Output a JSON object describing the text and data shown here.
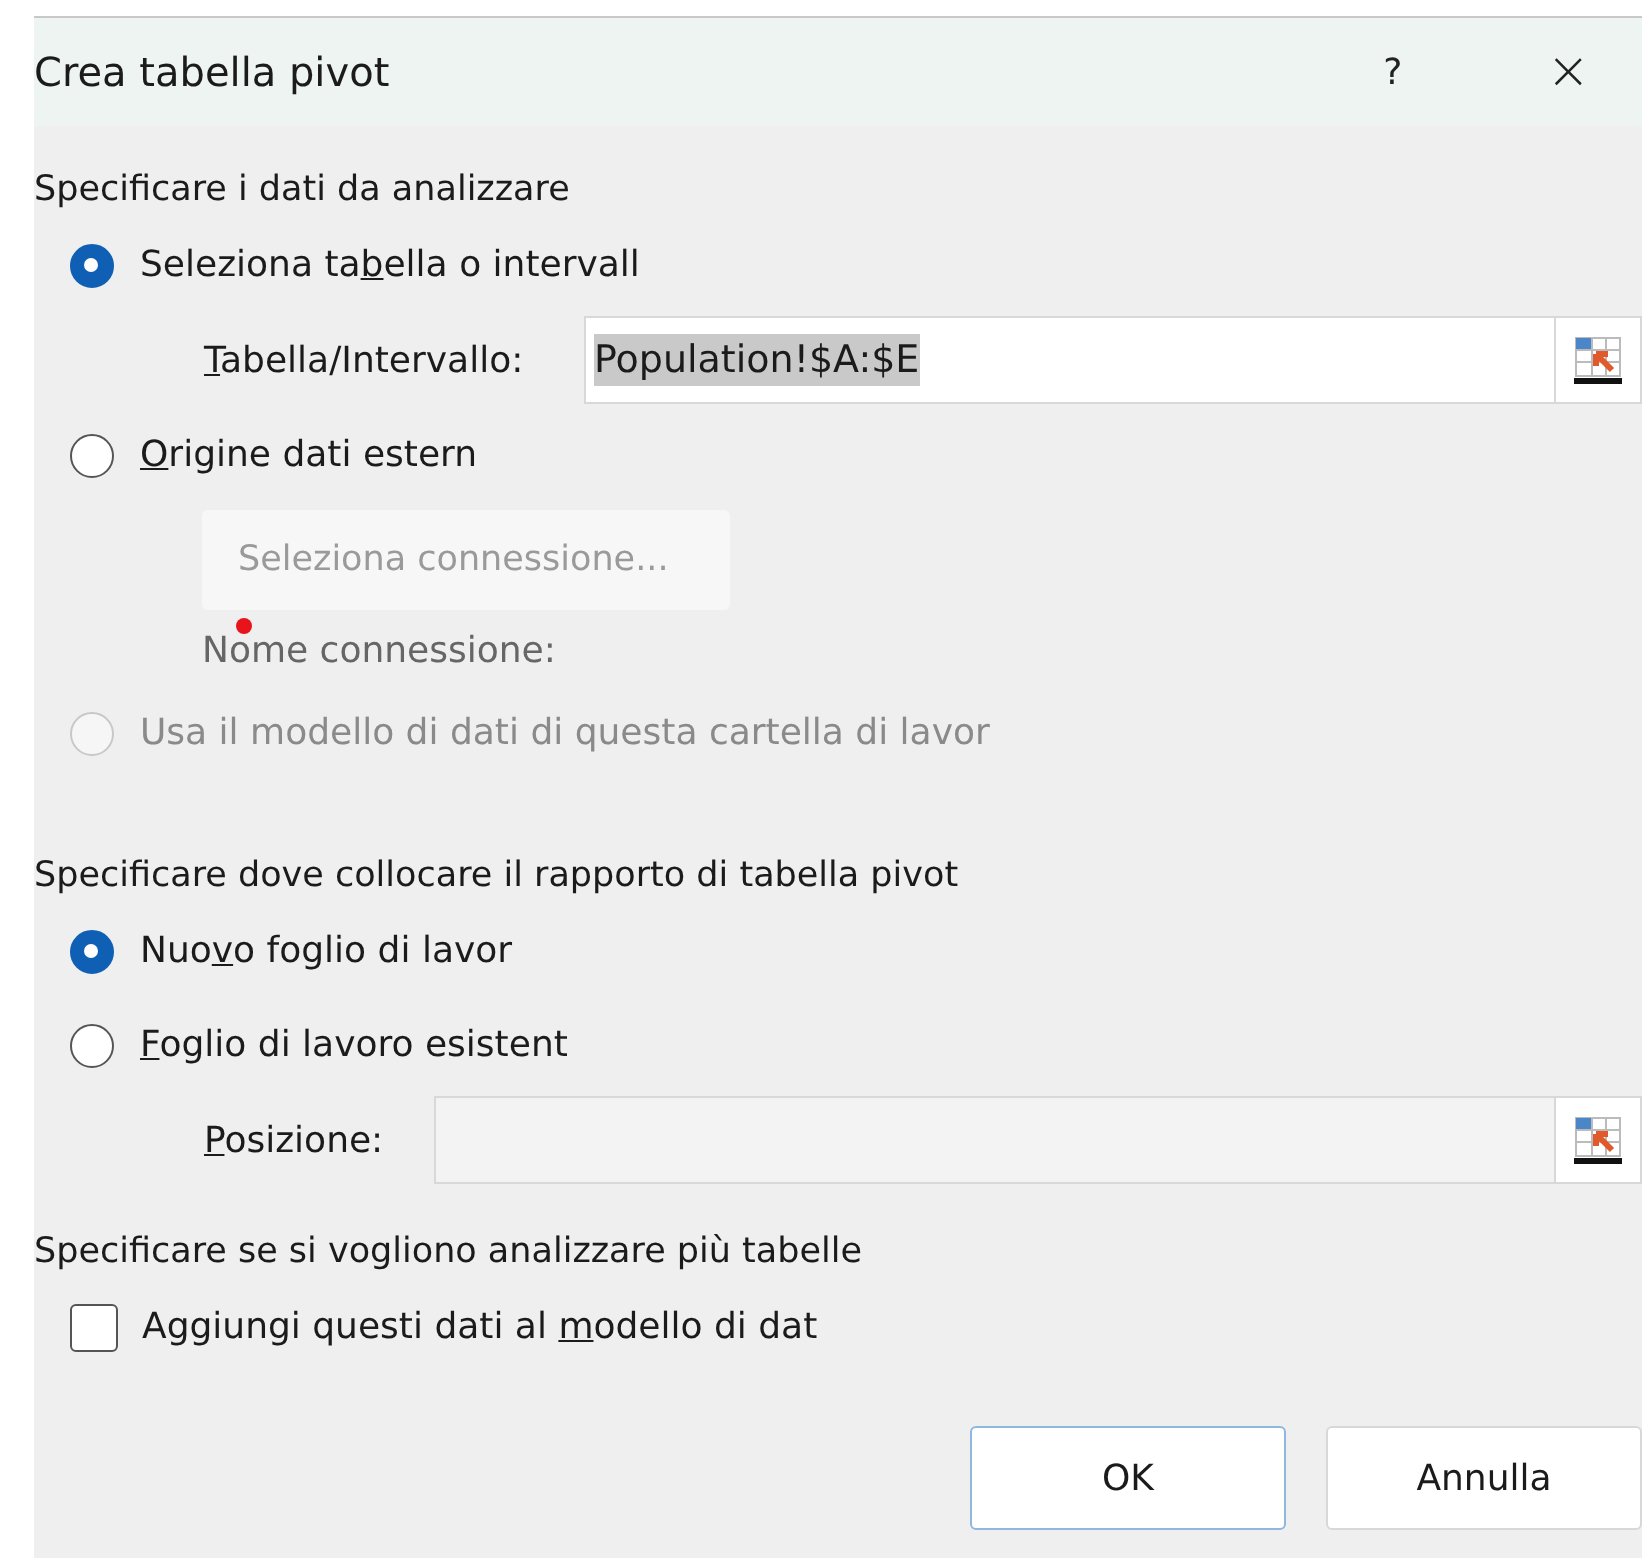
{
  "window": {
    "title": "Crea tabella pivot",
    "help": "?",
    "close": "×"
  },
  "source": {
    "heading": "Specificare i dati da analizzare",
    "range_option": {
      "label": {
        "before": "Seleziona ta",
        "key": "b",
        "after": "ella o intervall"
      },
      "selected": true,
      "disabled": false
    },
    "range_field": {
      "label": {
        "key": "T",
        "after": "abella/Intervallo:"
      },
      "value": "Population!$A:$E",
      "disabled": false
    },
    "external_option": {
      "label": {
        "key": "O",
        "after": "rigine dati estern"
      },
      "selected": false,
      "disabled": false
    },
    "connection_button": {
      "label": "Seleziona connessione...",
      "disabled": true
    },
    "connection_name": "Nome connessione:",
    "model_option": {
      "label": "Usa il modello di dati di questa cartella di lavor",
      "selected": false,
      "disabled": true
    }
  },
  "destination": {
    "heading": "Specificare dove collocare il rapporto di tabella pivot",
    "options": [
      {
        "label": {
          "before": "Nuo",
          "key": "v",
          "after": "o foglio di lavor"
        },
        "selected": true,
        "disabled": false
      },
      {
        "label": {
          "key": "F",
          "after": "oglio di lavoro esistent"
        },
        "selected": false,
        "disabled": false
      }
    ],
    "position_field": {
      "label": {
        "key": "P",
        "after": "osizione:"
      },
      "disabled": true
    }
  },
  "multiple": {
    "heading": "Specificare se si vogliono analizzare più tabelle",
    "checkbox": {
      "label": {
        "before": "Aggiungi questi dati al ",
        "key": "m",
        "after": "odello di dat"
      },
      "checked": false
    }
  },
  "buttons": [
    {
      "label": "OK",
      "default": true
    },
    {
      "label": "Annulla",
      "default": false
    }
  ]
}
